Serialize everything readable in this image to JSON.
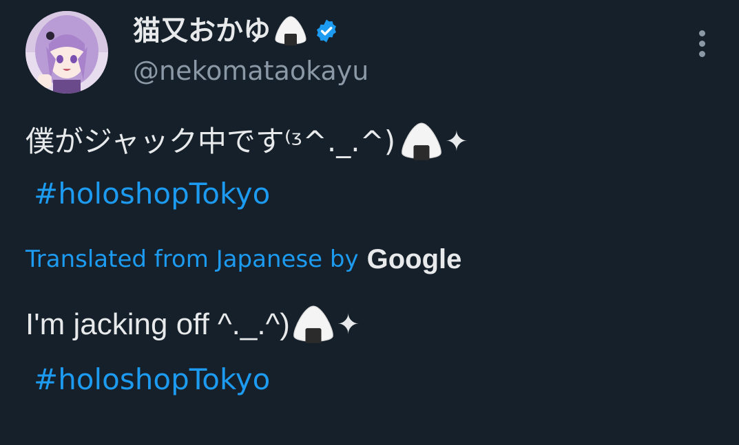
{
  "profile": {
    "display_name": "猫又おかゆ",
    "handle": "@nekomataokayu",
    "verified": true,
    "avatar_icon": "avatar-purple-hair-character"
  },
  "tweet": {
    "text": "僕がジャック中です⁽ᶾ^._.^)",
    "emoji_tail": "✦",
    "hashtag": "#holoshopTokyo"
  },
  "translation": {
    "label": "Translated from Japanese by",
    "provider": "Google",
    "text": "I'm jacking off ^._.^)",
    "emoji_tail": "✦",
    "hashtag": "#holoshopTokyo"
  },
  "colors": {
    "background": "#15202b",
    "text_primary": "#e7e9ea",
    "text_secondary": "#8b98a5",
    "accent": "#1d9bf0"
  },
  "icons": {
    "verified": "verified-badge-icon",
    "more": "more-vertical-icon",
    "rice_ball": "rice-ball-emoji",
    "sparkle": "sparkle-emoji"
  }
}
